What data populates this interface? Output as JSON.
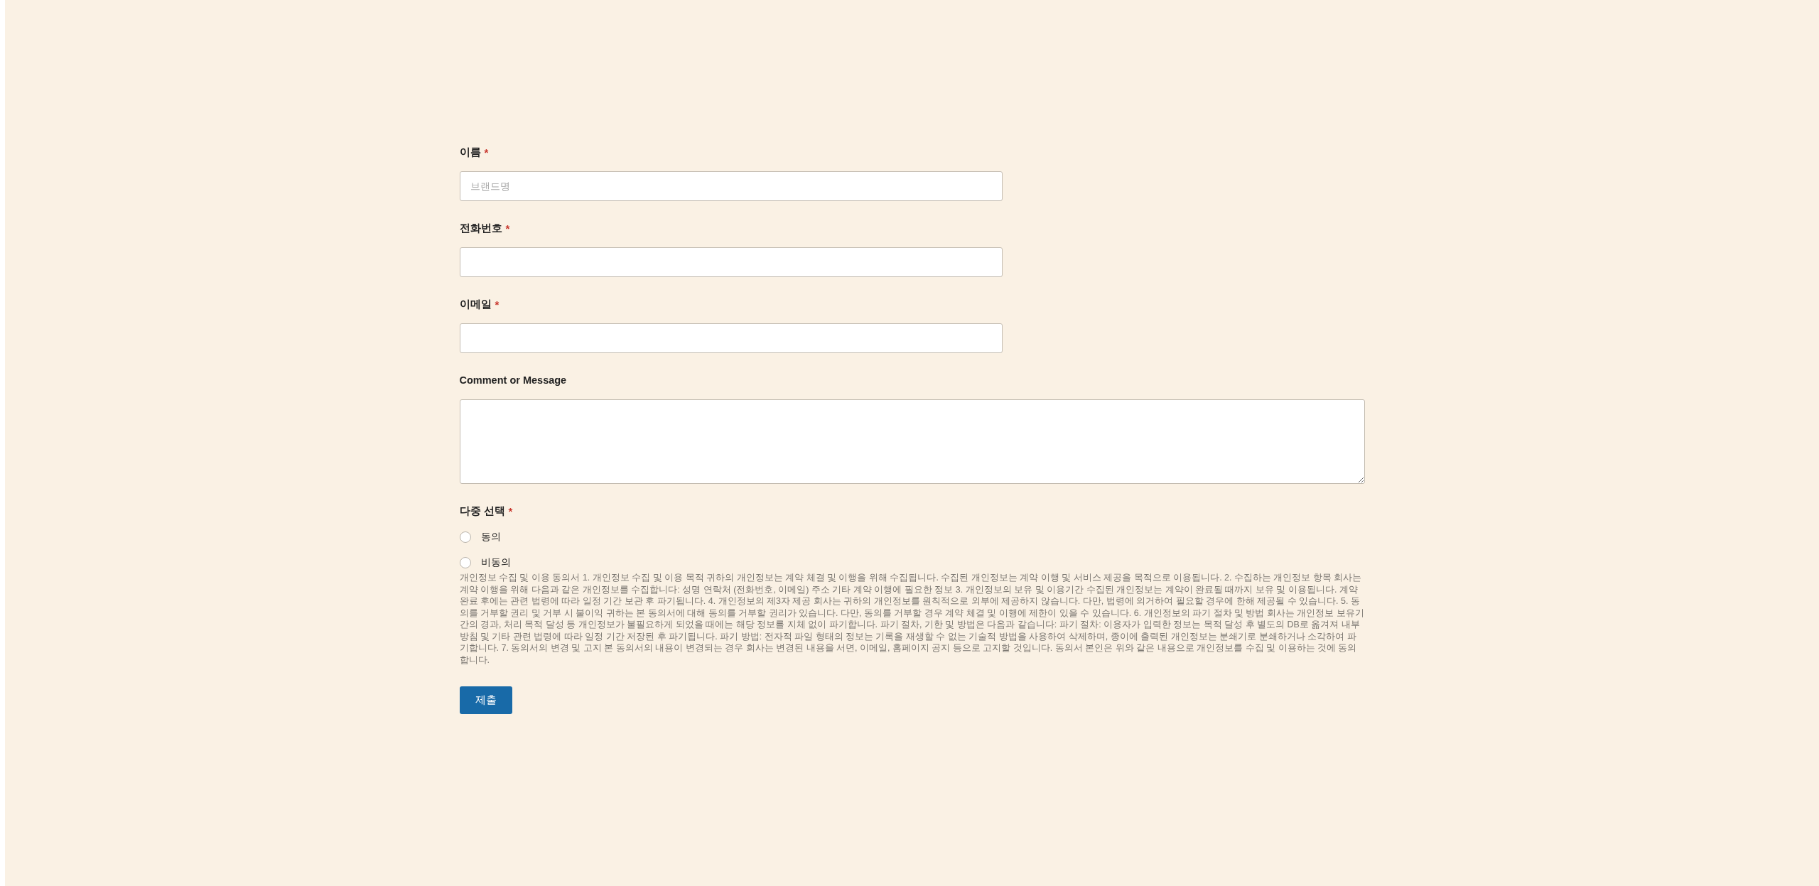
{
  "form": {
    "fields": [
      {
        "kind": "text",
        "label": "이름",
        "required_mark": "*",
        "placeholder": "브랜드명"
      },
      {
        "kind": "text",
        "label": "전화번호",
        "required_mark": "*"
      },
      {
        "kind": "text",
        "label": "이메일",
        "required_mark": "*"
      },
      {
        "kind": "textarea",
        "label": "Comment or Message"
      },
      {
        "kind": "radio",
        "label": "다중 선택",
        "required_mark": "*",
        "options": [
          {
            "label": "동의",
            "selected": false
          },
          {
            "label": "비동의",
            "selected": false
          }
        ],
        "note": "개인정보 수집 및 이용 동의서 1. 개인정보 수집 및 이용 목적 귀하의 개인정보는 계약 체결 및 이행을 위해 수집됩니다. 수집된 개인정보는 계약 이행 및 서비스 제공을 목적으로 이용됩니다. 2. 수집하는 개인정보 항목 회사는 계약 이행을 위해 다음과 같은 개인정보를 수집합니다: 성명 연락처 (전화번호, 이메일) 주소 기타 계약 이행에 필요한 정보 3. 개인정보의 보유 및 이용기간 수집된 개인정보는 계약이 완료될 때까지 보유 및 이용됩니다. 계약 완료 후에는 관련 법령에 따라 일정 기간 보관 후 파기됩니다. 4. 개인정보의 제3자 제공 회사는 귀하의 개인정보를 원칙적으로 외부에 제공하지 않습니다. 다만, 법령에 의거하여 필요할 경우에 한해 제공될 수 있습니다. 5. 동의를 거부할 권리 및 거부 시 불이익 귀하는 본 동의서에 대해 동의를 거부할 권리가 있습니다. 다만, 동의를 거부할 경우 계약 체결 및 이행에 제한이 있을 수 있습니다. 6. 개인정보의 파기 절차 및 방법 회사는 개인정보 보유기간의 경과, 처리 목적 달성 등 개인정보가 불필요하게 되었을 때에는 해당 정보를 지체 없이 파기합니다. 파기 절차, 기한 및 방법은 다음과 같습니다: 파기 절차: 이용자가 입력한 정보는 목적 달성 후 별도의 DB로 옮겨져 내부 방침 및 기타 관련 법령에 따라 일정 기간 저장된 후 파기됩니다. 파기 방법: 전자적 파일 형태의 정보는 기록을 재생할 수 없는 기술적 방법을 사용하여 삭제하며, 종이에 출력된 개인정보는 분쇄기로 분쇄하거나 소각하여 파기합니다. 7. 동의서의 변경 및 고지 본 동의서의 내용이 변경되는 경우 회사는 변경된 내용을 서면, 이메일, 홈페이지 공지 등으로 고지할 것입니다. 동의서 본인은 위와 같은 내용으로 개인정보를 수집 및 이용하는 것에 동의합니다."
      }
    ],
    "submit_button": {
      "label": "제출"
    }
  }
}
